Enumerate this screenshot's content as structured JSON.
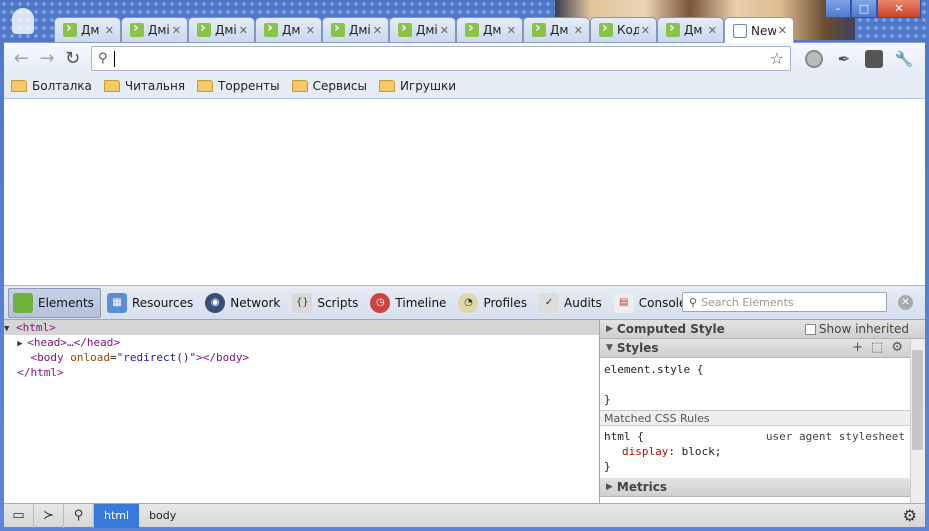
{
  "tabs": [
    {
      "title": "Дм"
    },
    {
      "title": "Дмі"
    },
    {
      "title": "Дмі"
    },
    {
      "title": "Дм"
    },
    {
      "title": "Дмі"
    },
    {
      "title": "Дмі"
    },
    {
      "title": "Дм"
    },
    {
      "title": "Дм"
    },
    {
      "title": "Код"
    },
    {
      "title": "Дм"
    },
    {
      "title": "New",
      "active": true
    }
  ],
  "toolbar": {
    "omnibox_value": "",
    "icons": [
      "back-icon",
      "forward-icon",
      "reload-icon",
      "search-icon",
      "star-icon",
      "wrench-icon"
    ]
  },
  "bookmarks": [
    {
      "label": "Болталка"
    },
    {
      "label": "Читальня"
    },
    {
      "label": "Торренты"
    },
    {
      "label": "Сервисы"
    },
    {
      "label": "Игрушки"
    }
  ],
  "devtools": {
    "tools": [
      {
        "label": "Elements",
        "selected": true
      },
      {
        "label": "Resources"
      },
      {
        "label": "Network"
      },
      {
        "label": "Scripts"
      },
      {
        "label": "Timeline"
      },
      {
        "label": "Profiles"
      },
      {
        "label": "Audits"
      },
      {
        "label": "Console"
      }
    ],
    "search_placeholder": "Search Elements",
    "dom": {
      "html_open": "<html>",
      "head": "<head>…</head>",
      "body_open": "<body",
      "body_attr": "onload",
      "body_attr_value": "\"redirect()\"",
      "body_close": "></body>",
      "html_close": "</html>"
    },
    "sidebar": {
      "computed_style": "Computed Style",
      "show_inherited": "Show inherited",
      "styles": "Styles",
      "element_style": "element.style {",
      "close_brace": "}",
      "matched_rules": "Matched CSS Rules",
      "html_rule": "html {",
      "ua_source": "user agent stylesheet",
      "prop_name": "display",
      "prop_value": "block;",
      "metrics": "Metrics"
    },
    "breadcrumbs": [
      {
        "label": "html",
        "active": true
      },
      {
        "label": "body"
      }
    ]
  }
}
